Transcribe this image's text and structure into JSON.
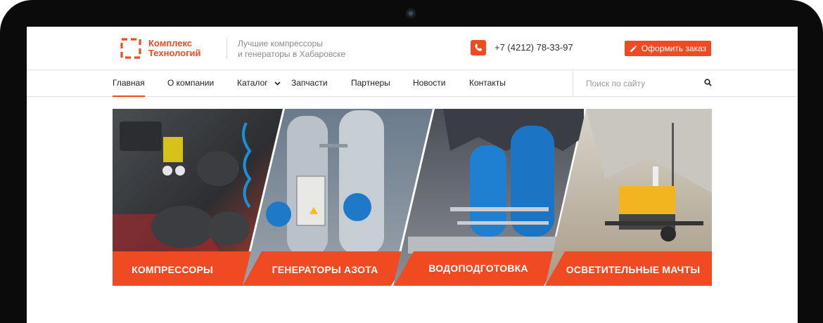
{
  "brand": {
    "name_line1": "Комплекс",
    "name_line2": "Технологий",
    "tagline_line1": "Лучшие компрессоры",
    "tagline_line2": "и генераторы в Хабаровске",
    "accent_color": "#f04a23"
  },
  "header": {
    "phone_icon": "phone-icon",
    "phone": "+7 (4212) 78-33-97",
    "order_button": "Оформить заказ",
    "order_icon": "pencil-icon"
  },
  "nav": {
    "items": [
      {
        "label": "Главная",
        "active": true
      },
      {
        "label": "О компании"
      },
      {
        "label": "Каталог",
        "has_dropdown": true
      },
      {
        "label": "Запчасти"
      },
      {
        "label": "Партнеры"
      },
      {
        "label": "Новости"
      },
      {
        "label": "Контакты"
      }
    ]
  },
  "search": {
    "placeholder": "Поиск по сайту",
    "icon": "search-icon"
  },
  "categories": [
    {
      "label": "КОМПРЕССОРЫ"
    },
    {
      "label": "ГЕНЕРАТОРЫ АЗОТА"
    },
    {
      "label": "ВОДОПОДГОТОВКА"
    },
    {
      "label": "ОСВЕТИТЕЛЬНЫЕ МАЧТЫ"
    }
  ]
}
